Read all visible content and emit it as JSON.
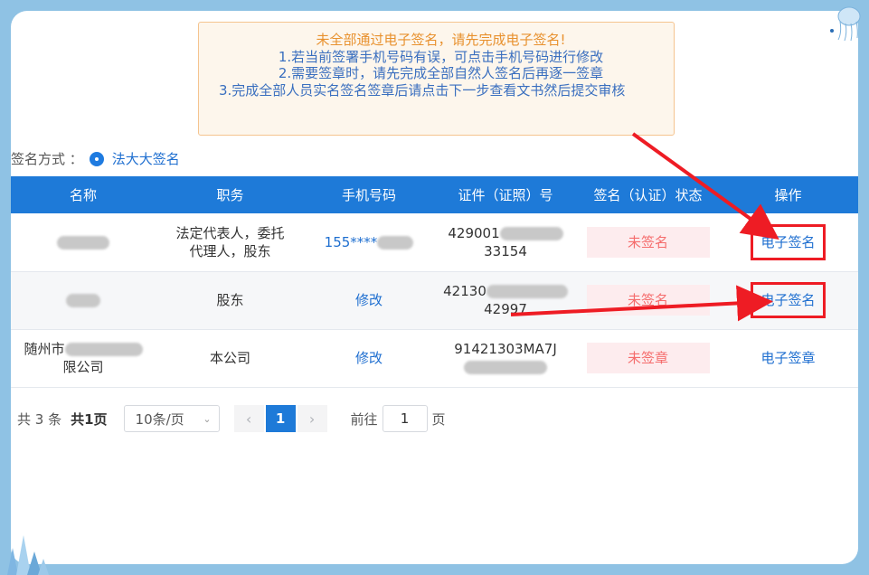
{
  "notice": {
    "title": "未全部通过电子签名，请先完成电子签名!",
    "line1": "1.若当前签署手机号码有误，可点击手机号码进行修改",
    "line2": "2.需要签章时，请先完成全部自然人签名后再逐一签章",
    "line3": "3.完成全部人员实名签名签章后请点击下一步查看文书然后提交审核"
  },
  "sign_method": {
    "label": "签名方式 ：",
    "value": "法大大签名"
  },
  "table": {
    "headers": [
      "名称",
      "职务",
      "手机号码",
      "证件（证照）号",
      "签名（认证）状态",
      "操作"
    ],
    "rows": [
      {
        "role_line1": "法定代表人，委托",
        "role_line2": "代理人，股东",
        "phone": "155****",
        "id_prefix": "429001",
        "id_suffix": "33154",
        "status": "未签名",
        "action": "电子签名"
      },
      {
        "role": "股东",
        "phone": "修改",
        "id_prefix": "42130",
        "id_suffix": "42997",
        "status": "未签名",
        "action": "电子签名"
      },
      {
        "name_line1": "随州市",
        "name_line2": "限公司",
        "role": "本公司",
        "phone": "修改",
        "id_prefix": "91421303MA7J",
        "status": "未签章",
        "action": "电子签章"
      }
    ]
  },
  "pager": {
    "total": "共 3 条",
    "pages": "共1页",
    "page_size": "10条/页",
    "current": "1",
    "goto_label": "前往",
    "goto_value": "1",
    "goto_unit": "页"
  },
  "colors": {
    "header_bg": "#1e7ad8",
    "highlight": "#ee1c24",
    "status_text": "#f56c6c",
    "link": "#1f6fd0"
  }
}
